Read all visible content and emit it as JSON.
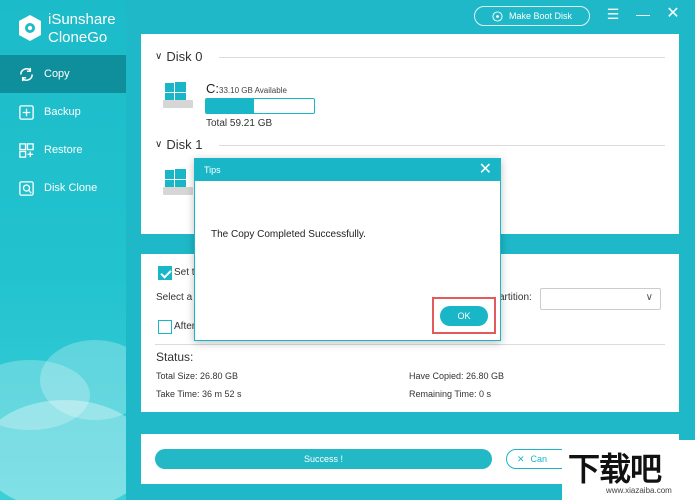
{
  "app": {
    "name_line1": "iSunshare",
    "name_line2": "CloneGo"
  },
  "topbar": {
    "boot_button_label": "Make Boot Disk"
  },
  "sidebar": {
    "items": [
      {
        "label": "Copy",
        "icon": "refresh-icon",
        "active": true
      },
      {
        "label": "Backup",
        "icon": "backup-icon",
        "active": false
      },
      {
        "label": "Restore",
        "icon": "restore-icon",
        "active": false
      },
      {
        "label": "Disk Clone",
        "icon": "disk-clone-icon",
        "active": false
      }
    ]
  },
  "disks": [
    {
      "name": "Disk 0",
      "partition": {
        "letter": "C:",
        "available": "33.10 GB Available",
        "total": "Total 59.21 GB",
        "used_fraction": 0.44
      }
    },
    {
      "name": "Disk 1"
    }
  ],
  "options": {
    "set_label": "Set t",
    "select_label": "Select a",
    "partition_label": "artition:",
    "after_label": "After"
  },
  "status": {
    "title": "Status:",
    "total_size": "Total Size: 26.80 GB",
    "take_time": "Take Time: 36 m 52 s",
    "have_copied": "Have Copied: 26.80 GB",
    "remaining_time": "Remaining Time: 0 s"
  },
  "bottom": {
    "success_label": "Success !",
    "cancel_label": "Can"
  },
  "dialog": {
    "title": "Tips",
    "message": "The Copy Completed Successfully.",
    "ok_label": "OK"
  },
  "watermark": {
    "text": "下载吧",
    "url": "www.xiazaiba.com"
  },
  "colors": {
    "accent": "#18b6c7",
    "highlight": "#e35a5a"
  }
}
